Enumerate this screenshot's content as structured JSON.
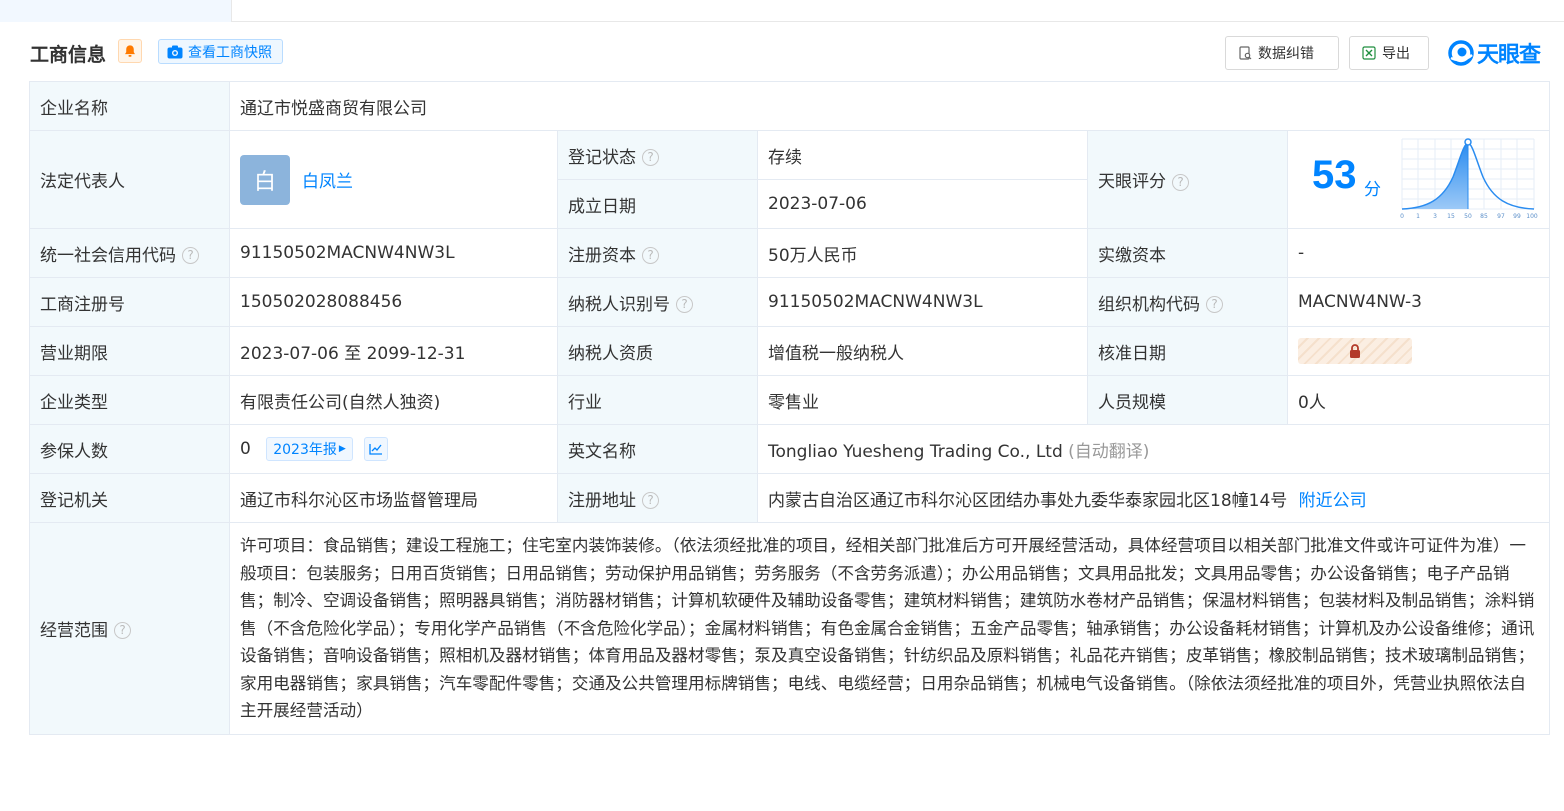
{
  "section": {
    "title": "工商信息",
    "snapshot_label": "查看工商快照",
    "correct_label": "数据纠错",
    "export_label": "导出",
    "logo_text": "天眼查"
  },
  "colors": {
    "accent": "#0084ff",
    "status_green": "#19a05a",
    "label_bg": "#f2f9fc",
    "bell": "#ff7a00"
  },
  "table": {
    "company_name_label": "企业名称",
    "company_name": "通辽市悦盛商贸有限公司",
    "legal_rep_label": "法定代表人",
    "legal_rep_avatar": "白",
    "legal_rep_name": "白凤兰",
    "reg_status_label": "登记状态",
    "reg_status": "存续",
    "found_date_label": "成立日期",
    "found_date": "2023-07-06",
    "tianyan_score_label": "天眼评分",
    "score": "53",
    "score_unit": "分",
    "score_ticks": [
      "0",
      "1",
      "3",
      "15",
      "50",
      "85",
      "97",
      "99",
      "100"
    ],
    "credit_code_label": "统一社会信用代码",
    "credit_code": "91150502MACNW4NW3L",
    "reg_capital_label": "注册资本",
    "reg_capital": "50万人民币",
    "paid_capital_label": "实缴资本",
    "paid_capital": "-",
    "biz_reg_no_label": "工商注册号",
    "biz_reg_no": "150502028088456",
    "taxpayer_id_label": "纳税人识别号",
    "taxpayer_id": "91150502MACNW4NW3L",
    "org_code_label": "组织机构代码",
    "org_code": "MACNW4NW-3",
    "biz_term_label": "营业期限",
    "biz_term": "2023-07-06 至 2099-12-31",
    "taxpayer_qual_label": "纳税人资质",
    "taxpayer_qual": "增值税一般纳税人",
    "approve_date_label": "核准日期",
    "company_type_label": "企业类型",
    "company_type": "有限责任公司(自然人独资)",
    "industry_label": "行业",
    "industry": "零售业",
    "staff_size_label": "人员规模",
    "staff_size": "0人",
    "insured_label": "参保人数",
    "insured": "0",
    "insured_report": "2023年报",
    "english_name_label": "英文名称",
    "english_name": "Tongliao Yuesheng Trading Co., Ltd",
    "english_name_note": "(自动翻译)",
    "reg_authority_label": "登记机关",
    "reg_authority": "通辽市科尔沁区市场监督管理局",
    "reg_address_label": "注册地址",
    "reg_address": "内蒙古自治区通辽市科尔沁区团结办事处九委华泰家园北区18幢14号",
    "nearby_label": "附近公司",
    "scope_label": "经营范围",
    "scope": "许可项目：食品销售；建设工程施工；住宅室内装饰装修。（依法须经批准的项目，经相关部门批准后方可开展经营活动，具体经营项目以相关部门批准文件或许可证件为准）一般项目：包装服务；日用百货销售；日用品销售；劳动保护用品销售；劳务服务（不含劳务派遣）；办公用品销售；文具用品批发；文具用品零售；办公设备销售；电子产品销售；制冷、空调设备销售；照明器具销售；消防器材销售；计算机软硬件及辅助设备零售；建筑材料销售；建筑防水卷材产品销售；保温材料销售；包装材料及制品销售；涂料销售（不含危险化学品）；专用化学产品销售（不含危险化学品）；金属材料销售；有色金属合金销售；五金产品零售；轴承销售；办公设备耗材销售；计算机及办公设备维修；通讯设备销售；音响设备销售；照相机及器材销售；体育用品及器材零售；泵及真空设备销售；针纺织品及原料销售；礼品花卉销售；皮革销售；橡胶制品销售；技术玻璃制品销售；家用电器销售；家具销售；汽车零配件零售；交通及公共管理用标牌销售；电线、电缆经营；日用杂品销售；机械电气设备销售。（除依法须经批准的项目外，凭营业执照依法自主开展经营活动）"
  }
}
